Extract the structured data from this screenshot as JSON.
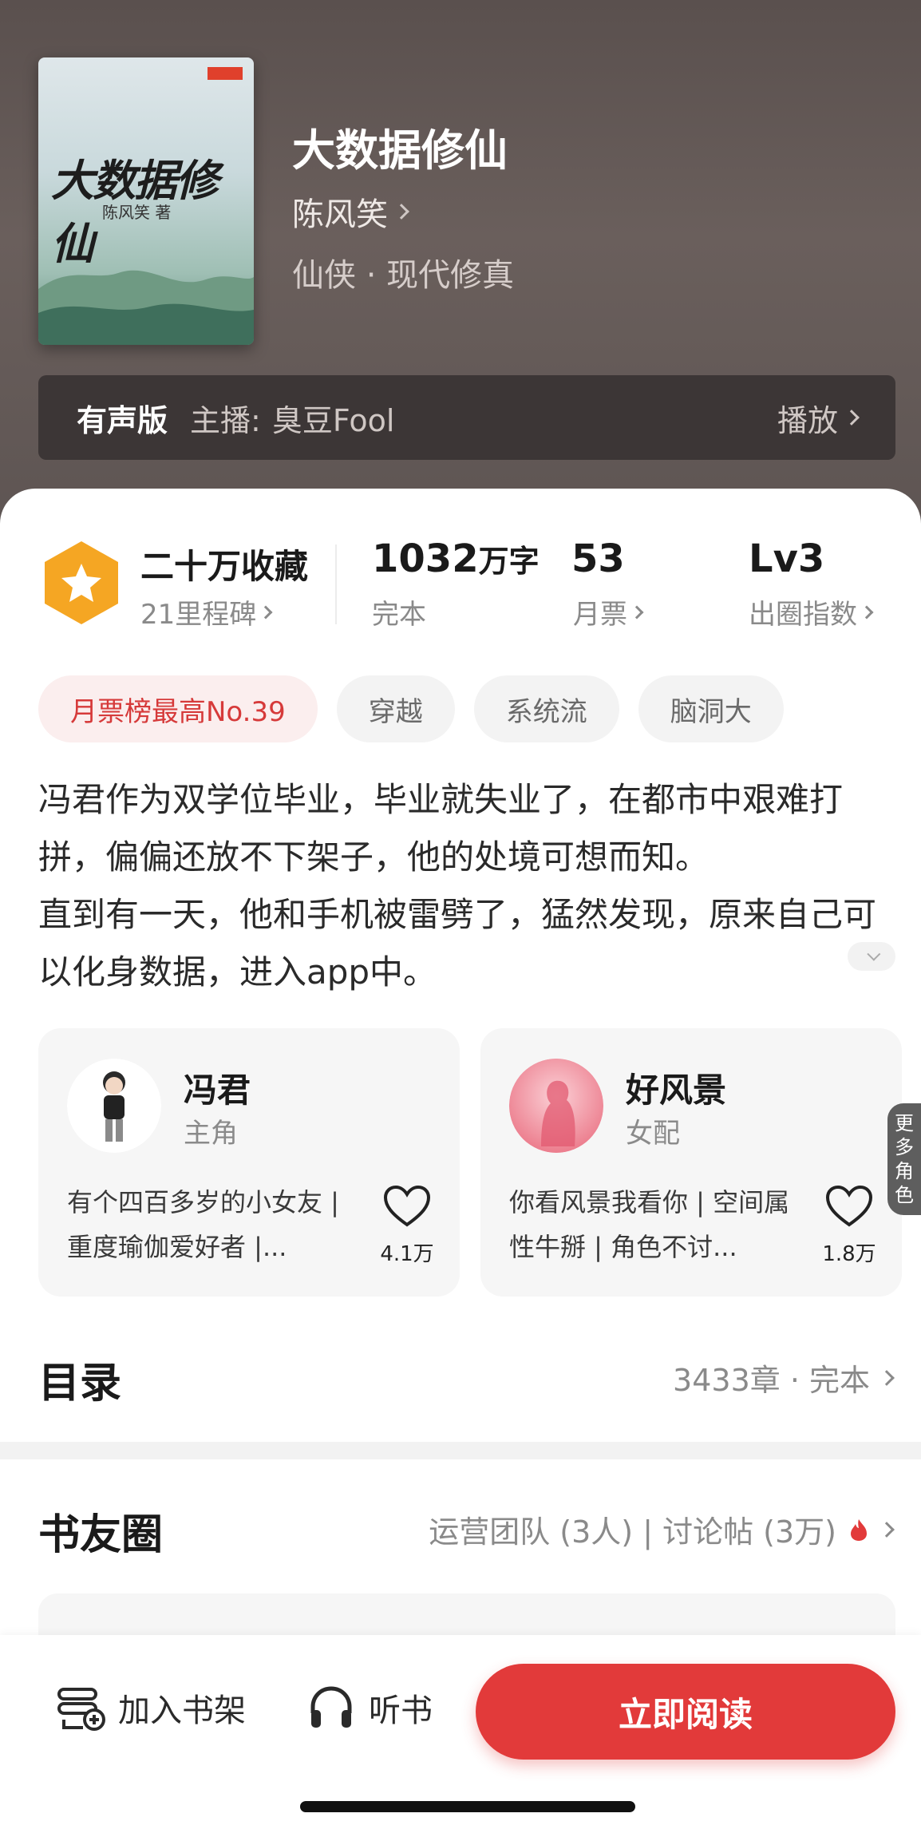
{
  "book": {
    "cover_title": "大数据修仙",
    "cover_author": "陈风笑 著",
    "title": "大数据修仙",
    "author": "陈风笑",
    "genre": "仙侠 · 现代修真"
  },
  "audio": {
    "tag": "有声版",
    "host_label": "主播:",
    "host": "臭豆Fool",
    "play_label": "播放"
  },
  "stats": {
    "favorites": "二十万收藏",
    "milestone": "21里程碑",
    "words_value": "1032",
    "words_unit": "万字",
    "status": "完本",
    "monthly_tickets": "53",
    "monthly_label": "月票",
    "level": "Lv3",
    "level_label": "出圈指数"
  },
  "tags": [
    "月票榜最高No.39",
    "穿越",
    "系统流",
    "脑洞大"
  ],
  "description": [
    "冯君作为双学位毕业，毕业就失业了，在都市中艰难打拼，偏偏还放不下架子，他的处境可想而知。",
    "直到有一天，他和手机被雷劈了，猛然发现，原来自己可以化身数据，进入app中。"
  ],
  "characters": [
    {
      "name": "冯君",
      "role": "主角",
      "intro": "有个四百多岁的小女友 | 重度瑜伽爱好者 |...",
      "likes": "4.1万"
    },
    {
      "name": "好风景",
      "role": "女配",
      "intro": "你看风景我看你 | 空间属性牛掰 | 角色不讨...",
      "likes": "1.8万"
    }
  ],
  "more_roles": [
    "更",
    "多",
    "角",
    "色"
  ],
  "toc": {
    "title": "目录",
    "meta": "3433章 · 完本"
  },
  "circle": {
    "title": "书友圈",
    "meta": "运营团队 (3人) | 讨论帖 (3万)"
  },
  "bottom": {
    "shelf": "加入书架",
    "listen": "听书",
    "read": "立即阅读"
  },
  "colors": {
    "accent": "#e23a3a",
    "hero_bg": "#5e5553",
    "badge": "#f5a623"
  }
}
